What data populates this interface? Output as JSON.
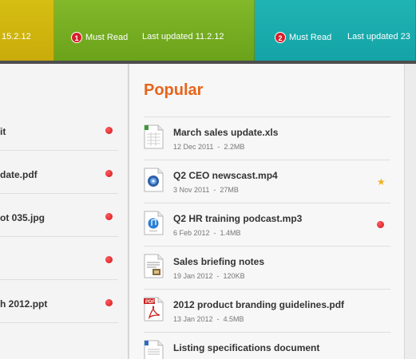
{
  "tiles": {
    "yellow": {
      "date_fragment": "15.2.12"
    },
    "green": {
      "badge": "1",
      "must_read": "Must Read",
      "updated": "Last updated 11.2.12"
    },
    "teal": {
      "badge": "2",
      "must_read": "Must Read",
      "updated": "Last updated 23"
    }
  },
  "left_panel": {
    "items": [
      {
        "name": "it",
        "unread": true
      },
      {
        "name": "date.pdf",
        "unread": true
      },
      {
        "name": "ot 035.jpg",
        "unread": true
      },
      {
        "name": "",
        "unread": true
      },
      {
        "name": "h 2012.ppt",
        "unread": true
      }
    ]
  },
  "popular": {
    "title": "Popular",
    "items": [
      {
        "title": "March sales update.xls",
        "date": "12 Dec 2011",
        "size": "2.2MB",
        "icon": "spreadsheet-icon",
        "marker": "none"
      },
      {
        "title": "Q2 CEO newscast.mp4",
        "date": "3 Nov 2011",
        "size": "27MB",
        "icon": "video-file-icon",
        "marker": "star"
      },
      {
        "title": "Q2 HR training podcast.mp3",
        "date": "6 Feb 2012",
        "size": "1.4MB",
        "icon": "audio-file-icon",
        "marker": "dot"
      },
      {
        "title": "Sales briefing notes",
        "date": "19 Jan 2012",
        "size": "120KB",
        "icon": "notes-file-icon",
        "marker": "none"
      },
      {
        "title": "2012 product branding guidelines.pdf",
        "date": "13 Jan 2012",
        "size": "4.5MB",
        "icon": "pdf-file-icon",
        "marker": "none"
      },
      {
        "title": "Listing specifications document",
        "date": "",
        "size": "",
        "icon": "document-icon",
        "marker": "none"
      }
    ]
  },
  "colors": {
    "accent_orange": "#e8641a",
    "unread_red": "#d0141c",
    "star_yellow": "#f2b21d",
    "tile_yellow": "#d6be12",
    "tile_green": "#82b92a",
    "tile_teal": "#20b4b4"
  }
}
